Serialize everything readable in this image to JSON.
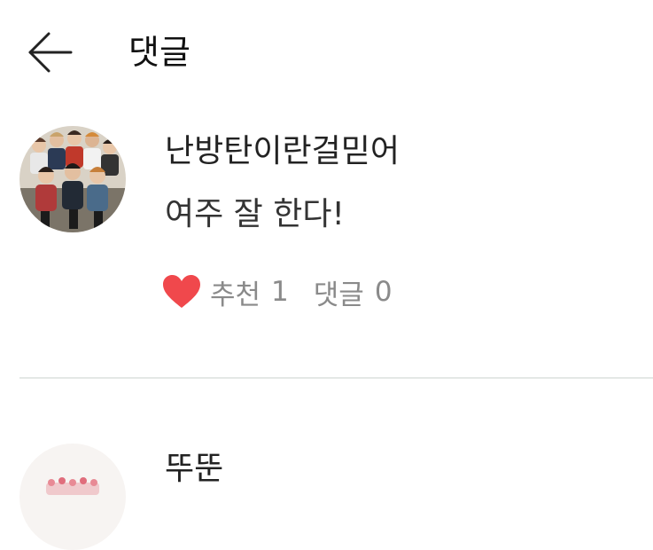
{
  "header": {
    "title": "댓글",
    "back_icon": "arrow-left-icon"
  },
  "comments": [
    {
      "username": "난방탄이란걸믿어",
      "text": "여주 잘 한다!",
      "like_label": "추천",
      "like_count": "1",
      "reply_label": "댓글",
      "reply_count": "0",
      "like_icon": "heart-icon",
      "like_color": "#f0484c"
    },
    {
      "username": "뚜뚠"
    }
  ],
  "colors": {
    "background": "#ffffff",
    "divider": "#e4e8e6",
    "meta_text": "#8a8a8a"
  }
}
